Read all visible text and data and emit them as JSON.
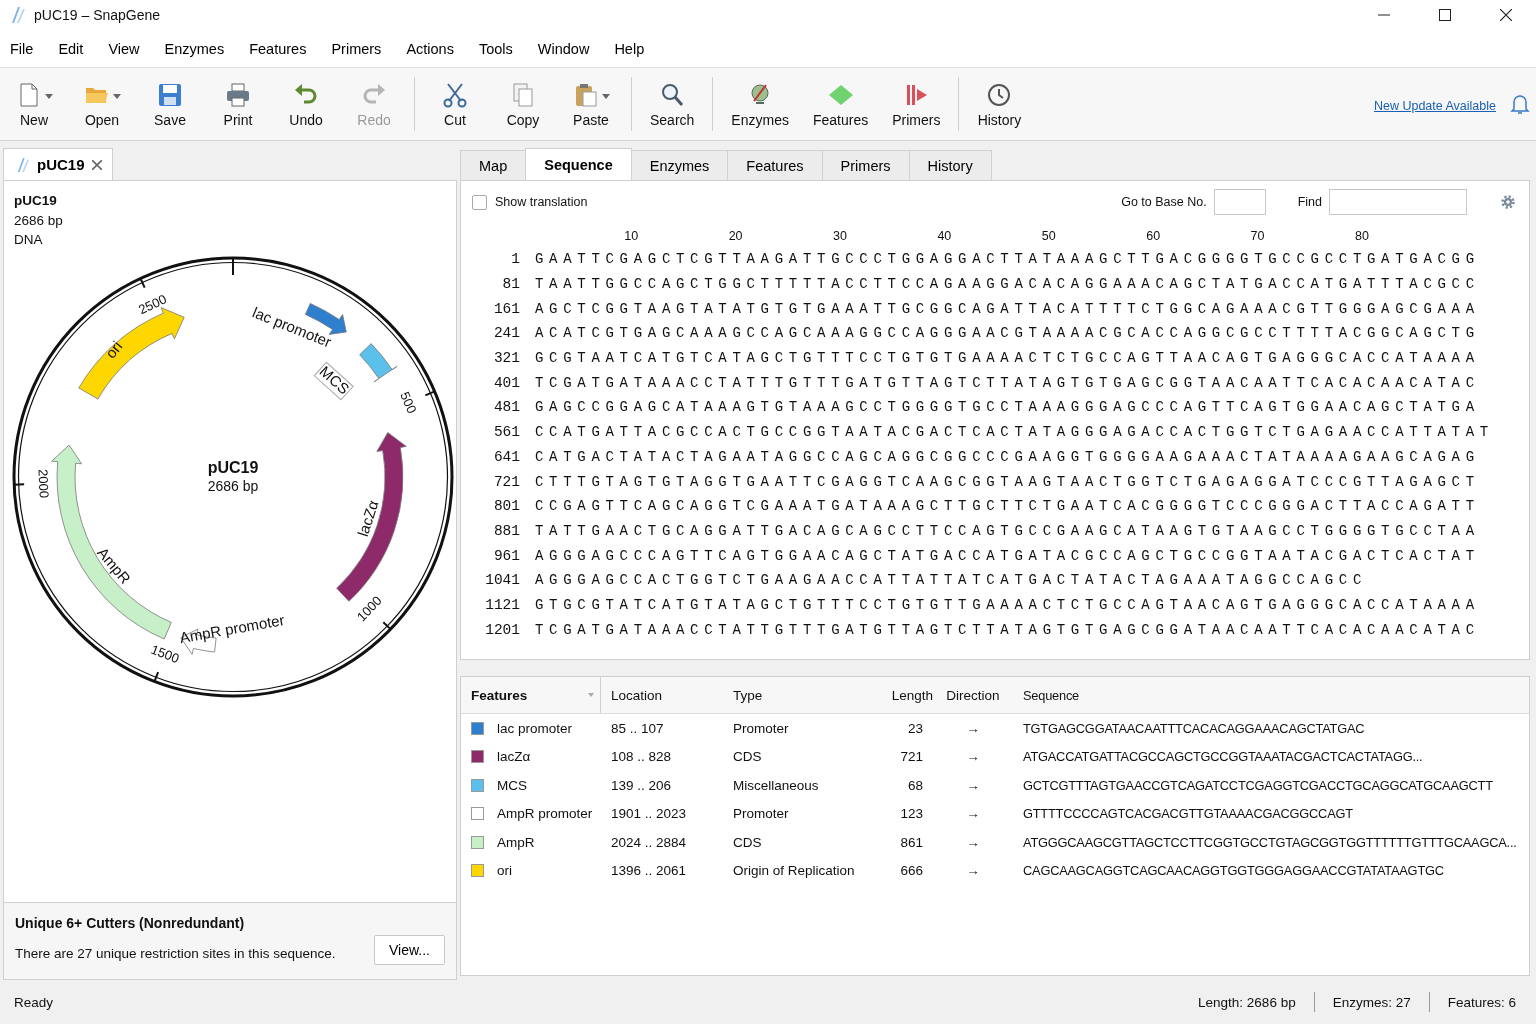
{
  "window": {
    "title": "pUC19 – SnapGene"
  },
  "menu": [
    "File",
    "Edit",
    "View",
    "Enzymes",
    "Features",
    "Primers",
    "Actions",
    "Tools",
    "Window",
    "Help"
  ],
  "toolbar_groups": [
    {
      "items": [
        {
          "label": "New",
          "disabled": false,
          "dropdown": true
        },
        {
          "label": "Open",
          "disabled": false,
          "dropdown": true
        },
        {
          "label": "Save",
          "disabled": false,
          "dropdown": false
        },
        {
          "label": "Print",
          "disabled": false,
          "dropdown": false
        },
        {
          "label": "Undo",
          "disabled": false,
          "dropdown": false
        },
        {
          "label": "Redo",
          "disabled": true,
          "dropdown": false
        }
      ]
    },
    {
      "items": [
        {
          "label": "Cut",
          "disabled": false,
          "dropdown": false
        },
        {
          "label": "Copy",
          "disabled": false,
          "dropdown": false
        },
        {
          "label": "Paste",
          "disabled": false,
          "dropdown": true
        }
      ]
    },
    {
      "items": [
        {
          "label": "Search",
          "disabled": false,
          "dropdown": false
        }
      ]
    },
    {
      "items": [
        {
          "label": "Enzymes",
          "disabled": false,
          "dropdown": false
        },
        {
          "label": "Features",
          "disabled": false,
          "dropdown": false
        },
        {
          "label": "Primers",
          "disabled": false,
          "dropdown": false
        }
      ]
    },
    {
      "items": [
        {
          "label": "History",
          "disabled": false,
          "dropdown": false
        }
      ]
    }
  ],
  "update_link": "New Update Available",
  "document_tab": {
    "label": "pUC19"
  },
  "sequence_info": {
    "name": "pUC19",
    "length": "2686 bp",
    "type": "DNA"
  },
  "map": {
    "title": "pUC19",
    "length": "2686 bp",
    "ticks": [
      "500",
      "1000",
      "1500",
      "2000",
      "2500"
    ],
    "feature_labels": [
      "lac promoter",
      "lacZα",
      "MCS",
      "AmpR promoter",
      "AmpR",
      "ori"
    ]
  },
  "cutters": {
    "heading": "Unique 6+ Cutters (Nonredundant)",
    "text": "There are 27 unique restriction sites in this sequence.",
    "button": "View..."
  },
  "view_tabs": [
    {
      "label": "Map",
      "selected": false
    },
    {
      "label": "Sequence",
      "selected": true
    },
    {
      "label": "Enzymes",
      "selected": false
    },
    {
      "label": "Features",
      "selected": false
    },
    {
      "label": "Primers",
      "selected": false
    },
    {
      "label": "History",
      "selected": false
    }
  ],
  "sequence_view": {
    "show_translation": {
      "label": "Show translation",
      "checked": false
    },
    "goto_label": "Go to Base No.",
    "find_label": "Find",
    "ruler": [
      "10",
      "20",
      "30",
      "40",
      "50",
      "60",
      "70",
      "80"
    ],
    "rows": [
      {
        "number": "1",
        "bases": "GAATTCGAGCTCGTTAAGATTGCCCTGGAGGACTTATAAAGCTTGACGGGGTGCCGCCTGATGACGG"
      },
      {
        "number": "81",
        "bases": "TAATTGGCCAGCTGGCTTTTTACCTTCCAGAAGGACACAGGAAACAGCTATGACCATGATTTACGCC"
      },
      {
        "number": "161",
        "bases": "AGCTCGGTAAGTATATGTGTGAAATTGCGGCAGATTACATTTTCTGGCAGAAACGTTGGGAGCGAAA"
      },
      {
        "number": "241",
        "bases": "ACATCGTGAGCAAAGCCAGCAAAGGCCAGGGAACGTAAAACGCACCAGGCGCCTTTTACGGCAGCTG"
      },
      {
        "number": "321",
        "bases": "GCGTAATCATGTCATAGCTGTTTCCTGTGTGAAAACTCTGCCAGTTAACAGTGAGGGCACCATAAAA"
      },
      {
        "number": "401",
        "bases": "TCGATGATAAACCTATTTGTTTGATGTTAGTCTTATAGTGTGAGCGGTAACAATTCACACAACATAC"
      },
      {
        "number": "481",
        "bases": "GAGCCGGAGCATAAAGTGTAAAGCCTGGGGTGCCTAAAGGGAGCCCAGTTCAGTGGAACAGCTATGA"
      },
      {
        "number": "561",
        "bases": "CCATGATTACGCCACTGCCGGTAATACGACTCACTATAGGGAGACCACTGGTCTGAGAACCATTATAT"
      },
      {
        "number": "641",
        "bases": "CATGACTATACTAGAATAGGCCAGCAGGCGGCCCGAAGGTGGGGAAGAAACTATAAAAGAAGCAGAG"
      },
      {
        "number": "721",
        "bases": "CTTTGTAGTGTAGGTGAATTCGAGGTCAAGCGGTAAGTAACTGGTCTGAGAGGATCCCGTTAGAGCT"
      },
      {
        "number": "801",
        "bases": "CCGAGTTCAGCAGGTCGAAATGATAAAGCTTGCTTCTGAATCACGGGGTCCCGGGACTTACCAGATT"
      },
      {
        "number": "881",
        "bases": "TATTGAACTGCAGGATTGACAGCAGCCTTCCAGTGCCGAAGCATAAGTGTAAGCCTGGGGTGCCTAA"
      },
      {
        "number": "961",
        "bases": "AGGGAGCCCAGTTCAGTGGAACAGCTATGACCATGATACGCCAGCTGCCGGTAATACGACTCACTAT"
      },
      {
        "number": "1041",
        "bases": "AGGGAGCCACTGGTCTGAAGAACCATTATTATCATGACTATACTAGAAATAGGCCAGCC"
      },
      {
        "number": "1121",
        "bases": "GTGCGTATCATGTATAGCTGTTTCCTGTGTTGAAAACTCTGCCAGTAACAGTGAGGGCACCATAAAA"
      },
      {
        "number": "1201",
        "bases": "TCGATGATAAACCTATTGTTTGATGTTAGTCTTATAGTGTGAGCGGATAACAATTCACACAACATAC"
      }
    ]
  },
  "features": {
    "columns": [
      "Features",
      "Location",
      "Type",
      "Length",
      "Direction",
      "Sequence"
    ],
    "rows": [
      {
        "name": "lac promoter",
        "color": "#2f7fcf",
        "location": "85 .. 107",
        "type": "Promoter",
        "length": "23",
        "direction": "→",
        "sequence": "TGTGAGCGGATAACAATTTCACACAGGAAACAGCTATGAC"
      },
      {
        "name": "lacZα",
        "color": "#8e2a6a",
        "location": "108 .. 828",
        "type": "CDS",
        "length": "721",
        "direction": "→",
        "sequence": "ATGACCATGATTACGCCAGCTGCCGGTAAATACGACTCACTATAGG..."
      },
      {
        "name": "MCS",
        "color": "#5bc0eb",
        "location": "139 .. 206",
        "type": "Miscellaneous",
        "length": "68",
        "direction": "→",
        "sequence": "GCTCGTTTAGTGAACCGTCAGATCCTCGAGGTCGACCTGCAGGCATGCAAGCTT"
      },
      {
        "name": "AmpR promoter",
        "color": "#ffffff",
        "location": "1901 .. 2023",
        "type": "Promoter",
        "length": "123",
        "direction": "→",
        "sequence": "GTTTTCCCCAGTCACGACGTTGTAAAACGACGGCCAGT"
      },
      {
        "name": "AmpR",
        "color": "#c8f0c8",
        "location": "2024 .. 2884",
        "type": "CDS",
        "length": "861",
        "direction": "→",
        "sequence": "ATGGGCAAGCGTTAGCTCCTTCGGTGCCTGTAGCGGTGGTTTTTTGTTTGCAAGCA..."
      },
      {
        "name": "ori",
        "color": "#ffd700",
        "location": "1396 .. 2061",
        "type": "Origin of Replication",
        "length": "666",
        "direction": "→",
        "sequence": "CAGCAAGCAGGTCAGCAACAGGTGGTGGGAGGAACCGTATATAAGTGC"
      }
    ]
  },
  "status_bar": {
    "status": "Ready",
    "items": [
      "Length:  2686 bp",
      "Enzymes:  27",
      "Features:  6"
    ]
  }
}
